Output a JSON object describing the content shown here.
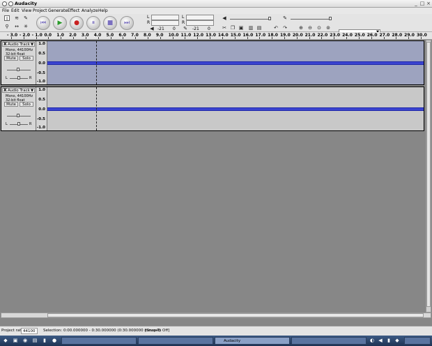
{
  "window": {
    "title": "Audacity"
  },
  "menu": [
    "File",
    "Edit",
    "View",
    "Project",
    "Generate",
    "Effect",
    "Analyze",
    "Help"
  ],
  "meters": {
    "l": "L",
    "r": "R",
    "db1": "-21",
    "db2": "0",
    "db3": "-21",
    "db4": "0"
  },
  "ruler": {
    "labels": [
      "- 3.0",
      "- 2.0",
      "- 1.0",
      "0.0",
      "1.0",
      "2.0",
      "3.0",
      "4.0",
      "5.0",
      "6.0",
      "7.0",
      "8.0",
      "9.0",
      "10.0",
      "11.0",
      "12.0",
      "13.0",
      "14.0",
      "15.0",
      "16.0",
      "17.0",
      "18.0",
      "19.0",
      "20.0",
      "21.0",
      "22.0",
      "23.0",
      "24.0",
      "25.0",
      "26.0",
      "27.0",
      "28.0",
      "29.0",
      "30.0"
    ]
  },
  "tracks": [
    {
      "name": "Audio Track",
      "close": "X",
      "format1": "Mono, 44100Hz",
      "format2": "32-bit float",
      "mute": "Mute",
      "solo": "Solo",
      "pan_l": "L",
      "pan_r": "R",
      "scale": [
        "1.0",
        "0.5",
        "0.0",
        "-0.5",
        "-1.0"
      ],
      "selected": true
    },
    {
      "name": "Audio Track",
      "close": "X",
      "format1": "Mono, 44100Hz",
      "format2": "32-bit float",
      "mute": "Mute",
      "solo": "Solo",
      "pan_l": "L",
      "pan_r": "R",
      "scale": [
        "1.0",
        "0.5",
        "0.0",
        "-0.5",
        "-1.0"
      ],
      "selected": false
    }
  ],
  "status": {
    "rate_label": "Project rate:",
    "rate_value": "44100",
    "selection": "Selection: 0:00.000000 - 0:30.000000 (0:30.000000 min:sec)",
    "snap": "[Snap-To Off]"
  },
  "taskbar": {
    "items": [
      {
        "label": "",
        "active": false
      },
      {
        "label": "",
        "active": false
      },
      {
        "label": "Audacity",
        "active": true
      },
      {
        "label": "",
        "active": false
      }
    ]
  }
}
